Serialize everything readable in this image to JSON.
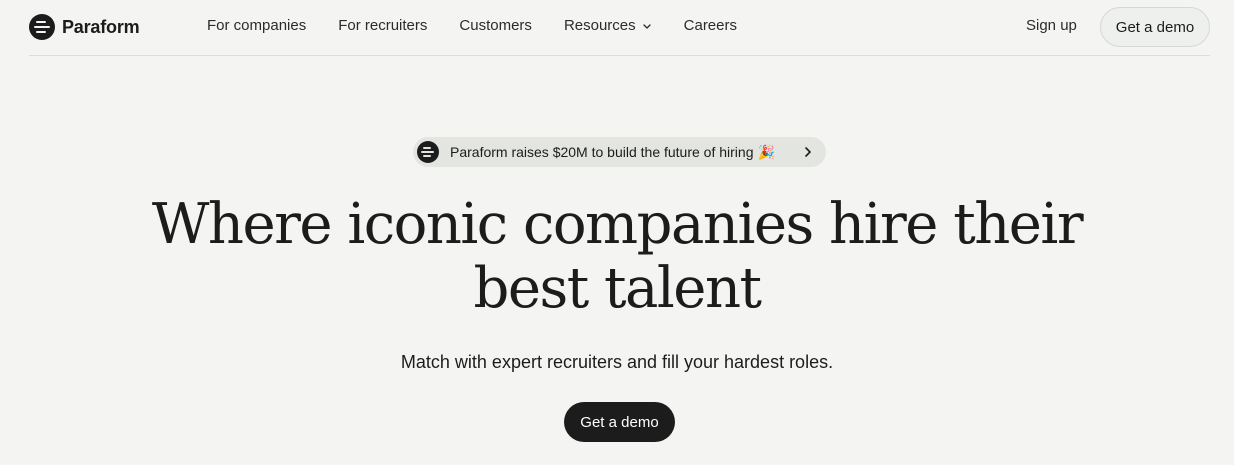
{
  "nav": {
    "brand": "Paraform",
    "links": [
      "For companies",
      "For recruiters",
      "Customers"
    ],
    "resources_label": "Resources",
    "careers_label": "Careers",
    "signup_label": "Sign up",
    "demo_label": "Get a demo"
  },
  "announcement": {
    "text": "Paraform raises $20M to build the future of hiring",
    "emoji": "🎉",
    "icon": "chevron-right-icon"
  },
  "hero": {
    "headline_line1": "Where iconic companies hire their",
    "headline_line2": "best talent",
    "subheadline": "Match with expert recruiters and fill your hardest roles.",
    "cta_label": "Get a demo"
  },
  "colors": {
    "background": "#f4f5f3",
    "primary": "#1c1c1c",
    "pill": "#e3e5e1"
  }
}
